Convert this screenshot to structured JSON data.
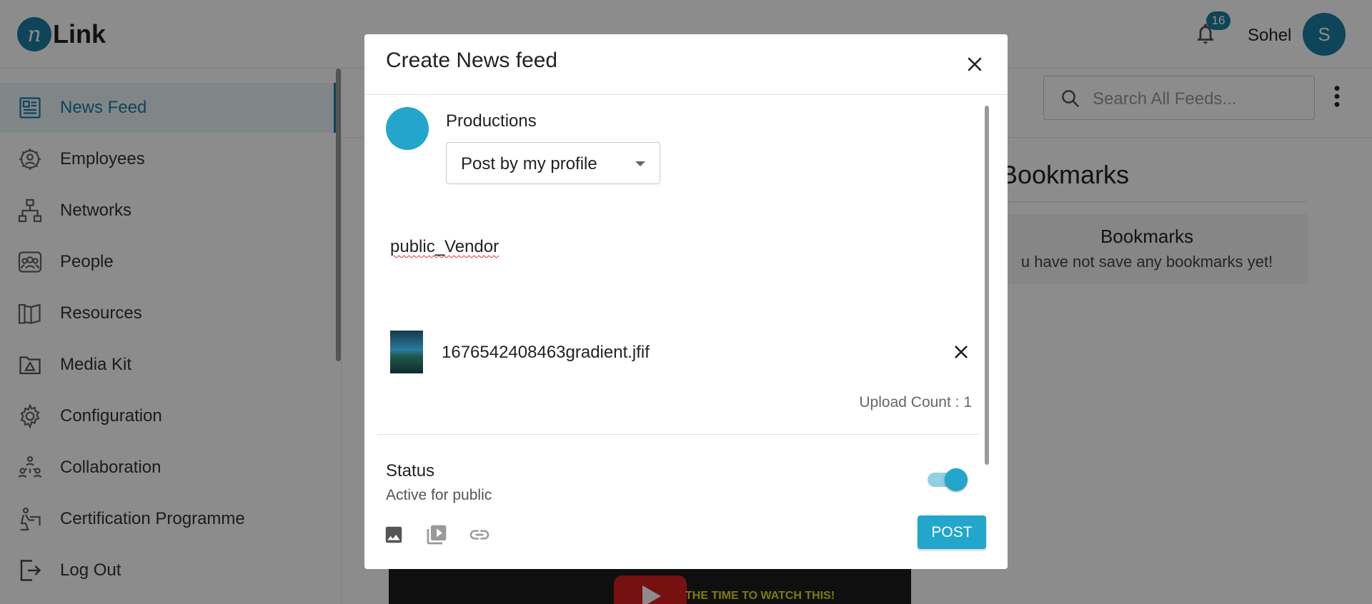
{
  "app": {
    "logo_mark": "n",
    "logo_text": "Link"
  },
  "header": {
    "notification_count": "16",
    "user_name": "Sohel",
    "avatar_initial": "S"
  },
  "sidebar": {
    "items": [
      {
        "label": "News Feed",
        "icon": "news-feed-icon",
        "active": true
      },
      {
        "label": "Employees",
        "icon": "employees-icon"
      },
      {
        "label": "Networks",
        "icon": "networks-icon"
      },
      {
        "label": "People",
        "icon": "people-icon"
      },
      {
        "label": "Resources",
        "icon": "resources-icon"
      },
      {
        "label": "Media Kit",
        "icon": "media-kit-icon"
      },
      {
        "label": "Configuration",
        "icon": "gear-icon"
      },
      {
        "label": "Collaboration",
        "icon": "collaboration-icon"
      },
      {
        "label": "Certification Programme",
        "icon": "certification-icon"
      }
    ],
    "logout_label": "Log Out"
  },
  "main": {
    "search_placeholder": "Search All Feeds...",
    "bookmarks_heading": "Bookmarks",
    "bookmarks_card_title": "Bookmarks",
    "bookmarks_card_text": "u have not save any bookmarks yet!",
    "video_caption": "THE TIME TO WATCH THIS!"
  },
  "modal": {
    "title": "Create News feed",
    "profile_name": "Productions",
    "post_as_selected": "Post by my profile",
    "post_text": "public_Vendor",
    "attachment_name": "1676542408463gradient.jfif",
    "upload_count": "Upload Count : 1",
    "status_title": "Status",
    "status_subtitle": "Active for public",
    "status_active": true,
    "post_button": "POST"
  },
  "colors": {
    "brand": "#1a7fa0",
    "accent": "#22a6cb",
    "active_bg": "#eaf5f8"
  }
}
